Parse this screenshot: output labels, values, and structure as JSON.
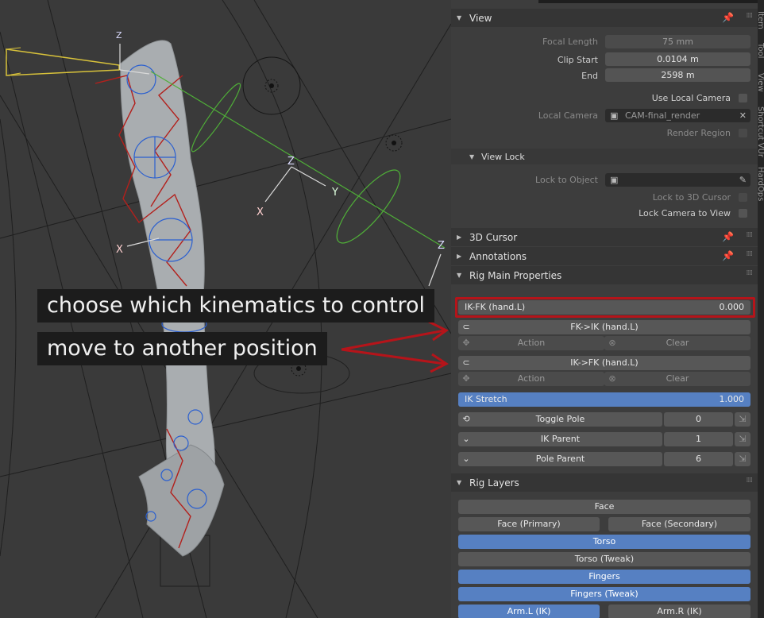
{
  "annotations": {
    "line1": "choose which kinematics to control",
    "line2": "move to another position"
  },
  "viewport_labels": {
    "axis_z": "Z",
    "axis_y": "Y",
    "axis_x": "X"
  },
  "side_tabs": [
    "Item",
    "Tool",
    "View",
    "Shortcut VUr",
    "HardOps"
  ],
  "view_panel": {
    "title": "View",
    "focal_length_label": "Focal Length",
    "focal_length_value": "75 mm",
    "clip_start_label": "Clip Start",
    "clip_start_value": "0.0104 m",
    "clip_end_label": "End",
    "clip_end_value": "2598 m",
    "use_local_camera_label": "Use Local Camera",
    "local_camera_label": "Local Camera",
    "local_camera_value": "CAM-final_render",
    "render_region_label": "Render Region",
    "view_lock": {
      "title": "View Lock",
      "lock_to_object_label": "Lock to Object",
      "lock_3d_cursor_label": "Lock to 3D Cursor",
      "lock_camera_label": "Lock Camera to View"
    }
  },
  "cursor_panel": {
    "title": "3D Cursor"
  },
  "annotations_panel": {
    "title": "Annotations"
  },
  "rig_main": {
    "title": "Rig Main Properties",
    "ik_fk_label": "IK-FK (hand.L)",
    "ik_fk_value": "0.000",
    "ik_fk_fraction": 0.0,
    "fk_to_ik_label": "FK->IK (hand.L)",
    "ik_to_fk_label": "IK->FK (hand.L)",
    "action_label": "Action",
    "clear_label": "Clear",
    "ik_stretch_label": "IK Stretch",
    "ik_stretch_value": "1.000",
    "ik_stretch_fraction": 1.0,
    "toggle_pole_label": "Toggle Pole",
    "toggle_pole_value": "0",
    "ik_parent_label": "IK Parent",
    "ik_parent_value": "1",
    "pole_parent_label": "Pole Parent",
    "pole_parent_value": "6"
  },
  "rig_layers": {
    "title": "Rig Layers",
    "face": "Face",
    "face_primary": "Face (Primary)",
    "face_secondary": "Face (Secondary)",
    "torso": "Torso",
    "torso_tweak": "Torso (Tweak)",
    "fingers": "Fingers",
    "fingers_tweak": "Fingers (Tweak)",
    "arm_l_ik": "Arm.L (IK)",
    "arm_r_ik": "Arm.R (IK)"
  },
  "colors": {
    "accent_blue": "#5680c2",
    "highlight_red": "#b5141a",
    "panel_bg": "#3d3d3d",
    "header_bg": "#353535"
  }
}
